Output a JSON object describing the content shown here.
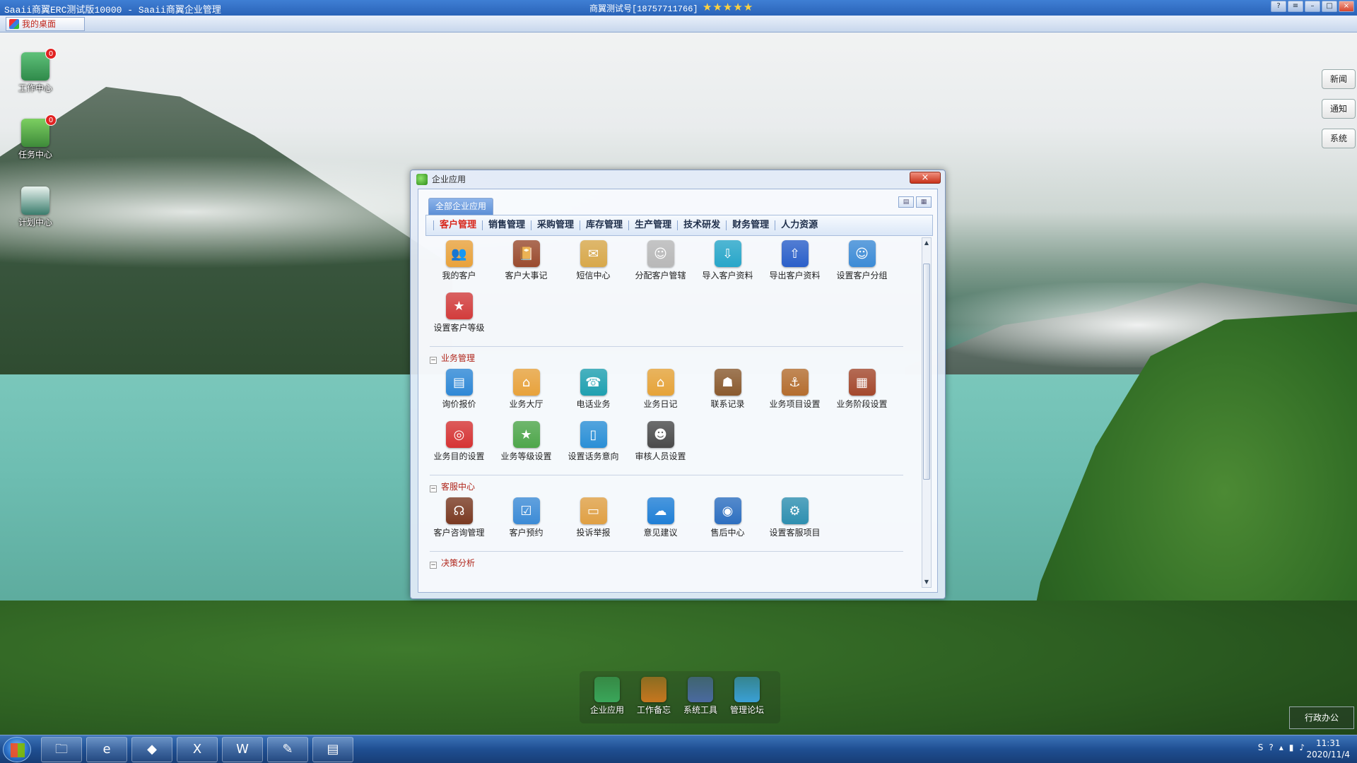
{
  "titlebar": {
    "app_title": "Saaii商翼ERC测试版10000 - Saaii商翼企业管理",
    "user_info": "商翼测试号[18757711766]",
    "rating": {
      "value": 5,
      "max": 5
    },
    "controls": [
      "?",
      "≡",
      "–",
      "□",
      "×"
    ]
  },
  "tabbar": {
    "desktop_tab": "我的桌面"
  },
  "desktop_icons": [
    {
      "label": "工作中心",
      "badge": "0",
      "color": "#2f8a4a"
    },
    {
      "label": "任务中心",
      "badge": "0",
      "color": "#3e8a3a"
    },
    {
      "label": "计划中心",
      "badge": "",
      "color": "#3a7c6c"
    }
  ],
  "side_buttons": [
    "新闻",
    "通知",
    "系统"
  ],
  "window": {
    "title": "企业应用",
    "close": "×",
    "tab_all": "全部企业应用",
    "view_buttons": [
      "▤",
      "▦"
    ],
    "categories": [
      "客户管理",
      "销售管理",
      "采购管理",
      "库存管理",
      "生产管理",
      "技术研发",
      "财务管理",
      "人力资源"
    ],
    "active_category": "客户管理",
    "sections": [
      {
        "title": "",
        "apps": [
          {
            "label": "我的客户",
            "icon": "users-icon",
            "color": "#e9a23b",
            "glyph": "👥"
          },
          {
            "label": "客户大事记",
            "icon": "notebook-icon",
            "color": "#9a4b2e",
            "glyph": "📔"
          },
          {
            "label": "短信中心",
            "icon": "message-icon",
            "color": "#d8a84a",
            "glyph": "✉"
          },
          {
            "label": "分配客户管辖",
            "icon": "assign-icon",
            "color": "#b8b8b8",
            "glyph": "☺"
          },
          {
            "label": "导入客户资料",
            "icon": "import-icon",
            "color": "#27a6c9",
            "glyph": "⇩"
          },
          {
            "label": "导出客户资料",
            "icon": "export-icon",
            "color": "#2a5fc9",
            "glyph": "⇧"
          },
          {
            "label": "设置客户分组",
            "icon": "group-icon",
            "color": "#3c8bd6",
            "glyph": "☺"
          },
          {
            "label": "设置客户等级",
            "icon": "level-icon",
            "color": "#d23c3c",
            "glyph": "★"
          }
        ]
      },
      {
        "title": "业务管理",
        "apps": [
          {
            "label": "询价报价",
            "icon": "quote-icon",
            "color": "#2e88d6",
            "glyph": "▤"
          },
          {
            "label": "业务大厅",
            "icon": "home-icon",
            "color": "#e8a23b",
            "glyph": "⌂"
          },
          {
            "label": "电话业务",
            "icon": "phone-icon",
            "color": "#1fa0b0",
            "glyph": "☎"
          },
          {
            "label": "业务日记",
            "icon": "diary-icon",
            "color": "#e6a338",
            "glyph": "⌂"
          },
          {
            "label": "联系记录",
            "icon": "contact-icon",
            "color": "#8a5a2e",
            "glyph": "☗"
          },
          {
            "label": "业务项目设置",
            "icon": "anchor-icon",
            "color": "#b46d2e",
            "glyph": "⚓"
          },
          {
            "label": "业务阶段设置",
            "icon": "stage-icon",
            "color": "#a4482c",
            "glyph": "▦"
          },
          {
            "label": "业务目的设置",
            "icon": "target-icon",
            "color": "#d63333",
            "glyph": "◎"
          },
          {
            "label": "业务等级设置",
            "icon": "star-icon",
            "color": "#4ea64a",
            "glyph": "★"
          },
          {
            "label": "设置话务意向",
            "icon": "mobile-icon",
            "color": "#2a8fd6",
            "glyph": "▯"
          },
          {
            "label": "审核人员设置",
            "icon": "person-icon",
            "color": "#4a4a4a",
            "glyph": "☻"
          }
        ]
      },
      {
        "title": "客服中心",
        "apps": [
          {
            "label": "客户咨询管理",
            "icon": "headset-icon",
            "color": "#7a3a22",
            "glyph": "☊"
          },
          {
            "label": "客户预约",
            "icon": "appointment-icon",
            "color": "#3c8bd6",
            "glyph": "☑"
          },
          {
            "label": "投诉举报",
            "icon": "complaint-icon",
            "color": "#e0a044",
            "glyph": "▭"
          },
          {
            "label": "意见建议",
            "icon": "bubble-icon",
            "color": "#1f7fd6",
            "glyph": "☁"
          },
          {
            "label": "售后中心",
            "icon": "globe-icon",
            "color": "#2d6fc0",
            "glyph": "◉"
          },
          {
            "label": "设置客服项目",
            "icon": "gear-icon",
            "color": "#2e8fb0",
            "glyph": "⚙"
          }
        ]
      },
      {
        "title": "决策分析",
        "apps": []
      }
    ]
  },
  "dock": [
    {
      "label": "企业应用",
      "icon": "home-icon",
      "color": "#3aa65a"
    },
    {
      "label": "工作备忘",
      "icon": "memo-icon",
      "color": "#c7771f"
    },
    {
      "label": "系统工具",
      "icon": "tools-icon",
      "color": "#4a6aa0"
    },
    {
      "label": "管理论坛",
      "icon": "forum-icon",
      "color": "#3aa0d6"
    }
  ],
  "office_button": "行政办公",
  "taskbar": {
    "apps": [
      "folder-icon",
      "ie-icon",
      "saaii-icon",
      "excel-icon",
      "word-icon",
      "paint-icon",
      "notepad-icon"
    ],
    "clock_time": "11:31",
    "clock_date": "2020/11/4"
  }
}
